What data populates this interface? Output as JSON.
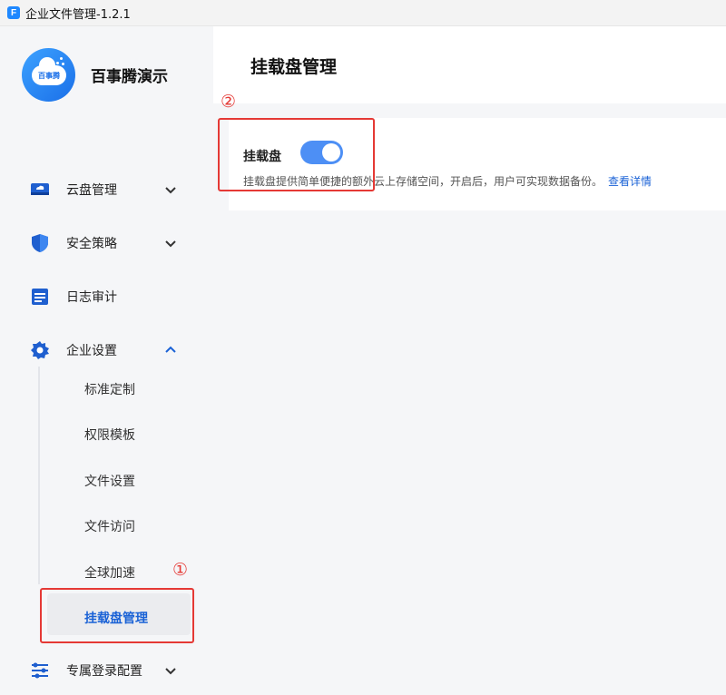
{
  "window": {
    "app_icon_letter": "F",
    "title": "企业文件管理-1.2.1"
  },
  "brand": {
    "logo_text": "百事腾",
    "name": "百事腾演示"
  },
  "sidebar": {
    "items": [
      {
        "label": "云盘管理",
        "icon": "cloud-drive-icon",
        "chevron": "down"
      },
      {
        "label": "安全策略",
        "icon": "shield-icon",
        "chevron": "down"
      },
      {
        "label": "日志审计",
        "icon": "log-icon",
        "chevron": null
      },
      {
        "label": "企业设置",
        "icon": "gear-icon",
        "chevron": "up"
      },
      {
        "label": "专属登录配置",
        "icon": "sliders-icon",
        "chevron": "down"
      }
    ],
    "sub_items": [
      {
        "label": "标准定制"
      },
      {
        "label": "权限模板"
      },
      {
        "label": "文件设置"
      },
      {
        "label": "文件访问"
      },
      {
        "label": "全球加速"
      },
      {
        "label": "挂载盘管理",
        "active": true
      }
    ]
  },
  "main": {
    "page_title": "挂载盘管理",
    "card": {
      "title": "挂载盘",
      "toggle_on": true,
      "description": "挂载盘提供简单便捷的额外云上存储空间，开启后，用户可实现数据备份。",
      "link_text": "查看详情"
    }
  },
  "annotations": {
    "one": "①",
    "two": "②",
    "color": "#e53935"
  },
  "colors": {
    "accent": "#1a62d6",
    "toggle": "#4d8ff5",
    "sidebar_bg": "#f5f6f8"
  }
}
